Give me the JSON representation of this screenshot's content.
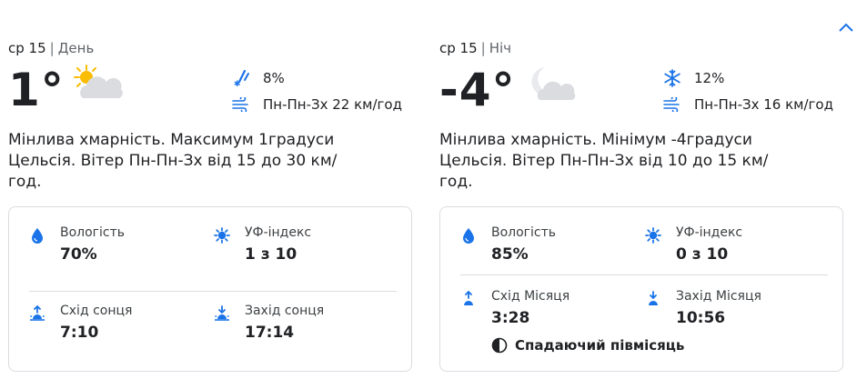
{
  "colors": {
    "accent": "#1a73e8",
    "text": "#202124",
    "muted": "#5f6368",
    "border": "#dadce0",
    "sun": "#fbbc04",
    "cloud": "#dadce0"
  },
  "header": {
    "collapse_icon": "chevron-up-icon"
  },
  "day": {
    "date": "ср 15",
    "period": "День",
    "temperature": "1°",
    "icon": "partly-cloudy-day-icon",
    "precip_icon": "rain-snow-icon",
    "precip": "8%",
    "wind_icon": "wind-icon",
    "wind": "Пн-Пн-Зх 22 км/год",
    "description": "Мінлива хмарність. Максимум 1градуси Цельсія. Вітер Пн-Пн-Зх від 15 до 30 км/год.",
    "humidity_label": "Вологість",
    "humidity_value": "70%",
    "uv_label": "УФ-індекс",
    "uv_value": "1 з 10",
    "rise_label": "Схід сонця",
    "rise_value": "7:10",
    "set_label": "Захід сонця",
    "set_value": "17:14"
  },
  "night": {
    "date": "ср 15",
    "period": "Ніч",
    "temperature": "-4°",
    "icon": "partly-cloudy-night-icon",
    "precip_icon": "snowflake-icon",
    "precip": "12%",
    "wind_icon": "wind-icon",
    "wind": "Пн-Пн-Зх 16 км/год",
    "description": "Мінлива хмарність. Мінімум -4градуси Цельсія. Вітер Пн-Пн-Зх від 10 до 15 км/год.",
    "humidity_label": "Вологість",
    "humidity_value": "85%",
    "uv_label": "УФ-індекс",
    "uv_value": "0 з 10",
    "rise_label": "Схід Місяця",
    "rise_value": "3:28",
    "set_label": "Захід Місяця",
    "set_value": "10:56",
    "moon_phase": "Спадаючий півмісяць"
  }
}
